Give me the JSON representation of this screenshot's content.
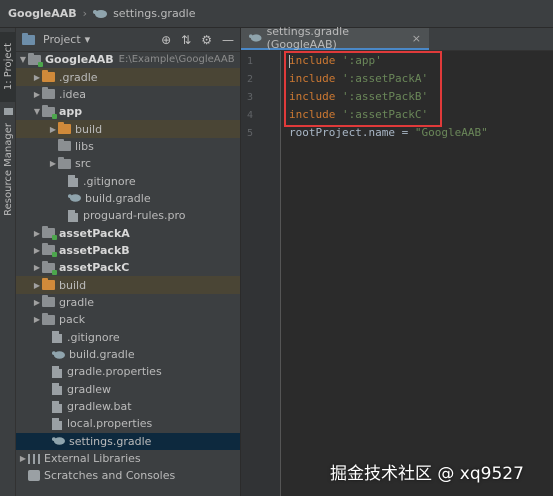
{
  "titlebar": {
    "project": "GoogleAAB",
    "file": "settings.gradle"
  },
  "left_strip": {
    "project_tab": "1: Project",
    "resource_tab": "Resource Manager"
  },
  "panel": {
    "view_label": "Project",
    "dropdown": "▾"
  },
  "tree": {
    "root": {
      "name": "GoogleAAB",
      "path": "E:\\Example\\GoogleAAB"
    },
    "items": [
      {
        "label": ".gradle"
      },
      {
        "label": ".idea"
      },
      {
        "label": "app"
      },
      {
        "label": "build"
      },
      {
        "label": "libs"
      },
      {
        "label": "src"
      },
      {
        "label": ".gitignore"
      },
      {
        "label": "build.gradle"
      },
      {
        "label": "proguard-rules.pro"
      },
      {
        "label": "assetPackA"
      },
      {
        "label": "assetPackB"
      },
      {
        "label": "assetPackC"
      },
      {
        "label": "build"
      },
      {
        "label": "gradle"
      },
      {
        "label": "pack"
      },
      {
        "label": ".gitignore"
      },
      {
        "label": "build.gradle"
      },
      {
        "label": "gradle.properties"
      },
      {
        "label": "gradlew"
      },
      {
        "label": "gradlew.bat"
      },
      {
        "label": "local.properties"
      },
      {
        "label": "settings.gradle"
      },
      {
        "label": "External Libraries"
      },
      {
        "label": "Scratches and Consoles"
      }
    ]
  },
  "editor": {
    "tab_label": "settings.gradle (GoogleAAB)",
    "line_numbers": [
      "1",
      "2",
      "3",
      "4",
      "5"
    ],
    "lines": [
      {
        "kw": "include",
        "str": "':app'"
      },
      {
        "kw": "include",
        "str": "':assetPackA'"
      },
      {
        "kw": "include",
        "str": "':assetPackB'"
      },
      {
        "kw": "include",
        "str": "':assetPackC'"
      },
      {
        "plain": "rootProject.name = ",
        "str": "\"GoogleAAB\""
      }
    ]
  },
  "watermark": "掘金技术社区 @ xq9527",
  "colors": {
    "keyword": "#cc7832",
    "string": "#6a8759",
    "highlight_box": "#e03a3a",
    "selection": "#0d293e"
  }
}
